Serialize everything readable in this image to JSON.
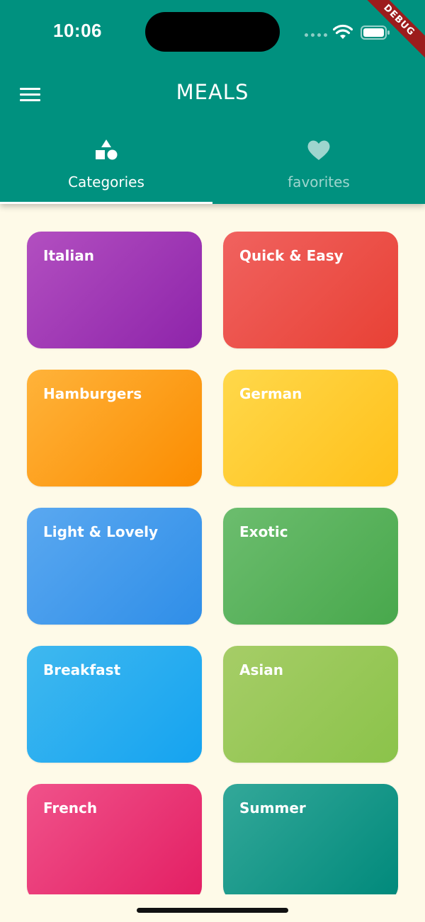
{
  "status": {
    "time": "10:06",
    "debug_banner": "DEBUG"
  },
  "appbar": {
    "title": "MEALS"
  },
  "tabs": [
    {
      "label": "Categories",
      "icon": "shapes-icon",
      "selected": true
    },
    {
      "label": "favorites",
      "icon": "heart-icon",
      "selected": false
    }
  ],
  "categories": [
    {
      "title": "Italian",
      "color_start": "#b24fc0",
      "color_end": "#8e24aa"
    },
    {
      "title": "Quick & Easy",
      "color_start": "#f0625f",
      "color_end": "#e84135"
    },
    {
      "title": "Hamburgers",
      "color_start": "#ffb33a",
      "color_end": "#fb8c00"
    },
    {
      "title": "German",
      "color_start": "#ffd84a",
      "color_end": "#ffc01a"
    },
    {
      "title": "Light & Lovely",
      "color_start": "#5aa8f0",
      "color_end": "#2f8ee8"
    },
    {
      "title": "Exotic",
      "color_start": "#6cbd6e",
      "color_end": "#48a84c"
    },
    {
      "title": "Breakfast",
      "color_start": "#3fb8ef",
      "color_end": "#15a3f0"
    },
    {
      "title": "Asian",
      "color_start": "#a6cd67",
      "color_end": "#8bc34a"
    },
    {
      "title": "French",
      "color_start": "#f0528a",
      "color_end": "#e31e63"
    },
    {
      "title": "Summer",
      "color_start": "#33a899",
      "color_end": "#00897b"
    }
  ]
}
